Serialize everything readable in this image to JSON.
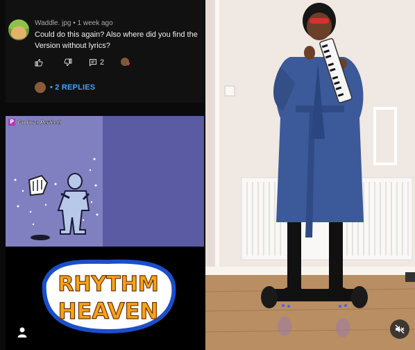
{
  "comment": {
    "author": "Waddle. jpg",
    "separator": "•",
    "time": "1 week ago",
    "text": "Could do this again? Also where did you find the Version without lyrics?",
    "dislike_count": "",
    "reply_count": "2",
    "replies_label": "• 2 REPLIES"
  },
  "game": {
    "badge": "P",
    "prompt": "Go for a Perfect!"
  },
  "logo": {
    "line1": "RHYTHM",
    "line2": "HEAVEN"
  },
  "colors": {
    "replies_link": "#3ea6ff",
    "game_bg": "#8080c0",
    "logo_orange": "#f7a21b"
  },
  "icons": {
    "like": "thumbs-up-icon",
    "dislike": "thumbs-down-icon",
    "reply": "comment-icon",
    "profile": "user-icon",
    "mute": "muted-speaker-icon"
  }
}
